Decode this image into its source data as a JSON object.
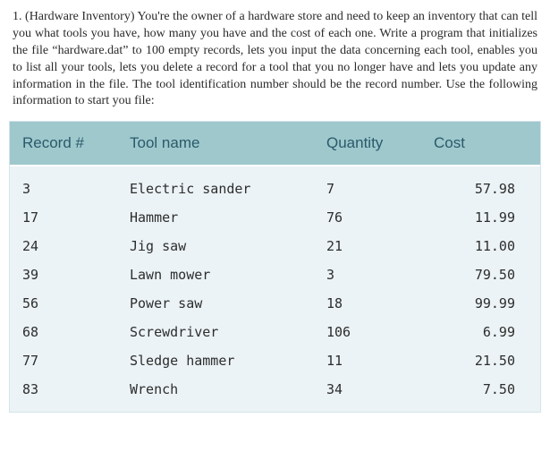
{
  "problem": {
    "text": "1. (Hardware Inventory) You're the owner of a hardware store and need to keep an inventory that can tell you what tools you have, how many you have and the cost of each one. Write a program that initializes the file “hardware.dat” to 100 empty records, lets you input the data concerning each tool, enables you to list all your tools, lets you delete a record for a tool that you no longer have and lets you update any information in the file. The tool identification number should be the record number. Use the following information to start you file:"
  },
  "table": {
    "headers": {
      "record": "Record #",
      "tool": "Tool name",
      "qty": "Quantity",
      "cost": "Cost"
    },
    "rows": [
      {
        "record": "3",
        "tool": "Electric sander",
        "qty": "7",
        "cost": "57.98"
      },
      {
        "record": "17",
        "tool": "Hammer",
        "qty": "76",
        "cost": "11.99"
      },
      {
        "record": "24",
        "tool": "Jig saw",
        "qty": "21",
        "cost": "11.00"
      },
      {
        "record": "39",
        "tool": "Lawn mower",
        "qty": "3",
        "cost": "79.50"
      },
      {
        "record": "56",
        "tool": "Power saw",
        "qty": "18",
        "cost": "99.99"
      },
      {
        "record": "68",
        "tool": "Screwdriver",
        "qty": "106",
        "cost": "6.99"
      },
      {
        "record": "77",
        "tool": "Sledge hammer",
        "qty": "11",
        "cost": "21.50"
      },
      {
        "record": "83",
        "tool": "Wrench",
        "qty": "34",
        "cost": "7.50"
      }
    ]
  }
}
